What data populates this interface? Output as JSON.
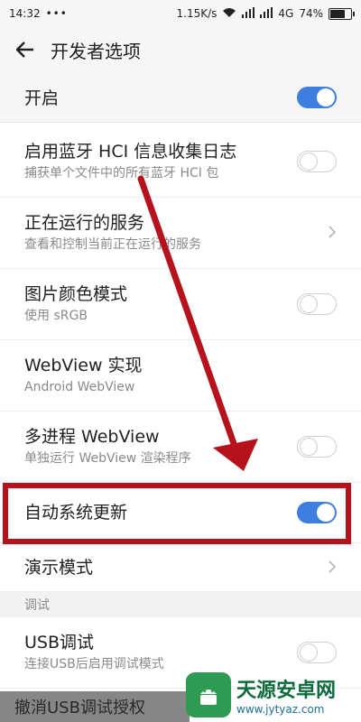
{
  "status_bar": {
    "time": "14:32",
    "dots": "•••",
    "speed": "1.15K/s",
    "network": "4G",
    "battery": "74%",
    "battery_level": 0.74
  },
  "app_bar": {
    "title": "开发者选项"
  },
  "master": {
    "label": "开启",
    "on": true
  },
  "rows": [
    {
      "title": "启用蓝牙 HCI 信息收集日志",
      "summary": "捕获单个文件中的所有蓝牙 HCI 包",
      "control": "toggle",
      "on": false
    },
    {
      "title": "正在运行的服务",
      "summary": "查看和控制当前正在运行的服务",
      "control": "chevron"
    },
    {
      "title": "图片颜色模式",
      "summary": "使用 sRGB",
      "control": "toggle",
      "on": false
    },
    {
      "title": "WebView 实现",
      "summary": "Android WebView",
      "control": "none"
    },
    {
      "title": "多进程 WebView",
      "summary": "单独运行 WebView 渲染程序",
      "control": "toggle",
      "on": false
    },
    {
      "title": "自动系统更新",
      "summary": "",
      "control": "toggle",
      "on": true
    },
    {
      "title": "演示模式",
      "summary": "",
      "control": "chevron"
    }
  ],
  "section": {
    "label": "调试"
  },
  "debug_rows": [
    {
      "title": "USB调试",
      "summary": "连接USB后启用调试模式",
      "control": "toggle",
      "on": false
    }
  ],
  "snackbar": {
    "text": "撤消USB调试授权"
  },
  "watermark": {
    "name": "天源安卓网",
    "url": "www.jytyaz.com"
  }
}
